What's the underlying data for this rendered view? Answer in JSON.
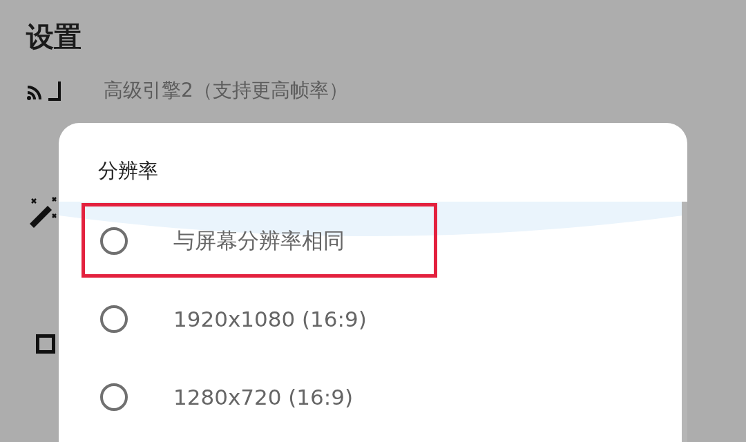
{
  "page": {
    "title": "设置"
  },
  "settings": [
    {
      "kind": "cast",
      "subtitle": "高级引擎2（支持更高帧率）"
    },
    {
      "kind": "wand"
    },
    {
      "kind": "square"
    }
  ],
  "dialog": {
    "title": "分辨率",
    "options": [
      {
        "label": "与屏幕分辨率相同",
        "selected": false,
        "highlighted": true
      },
      {
        "label": "1920x1080 (16:9)",
        "selected": false,
        "highlighted": false
      },
      {
        "label": "1280x720 (16:9)",
        "selected": false,
        "highlighted": false
      }
    ]
  }
}
